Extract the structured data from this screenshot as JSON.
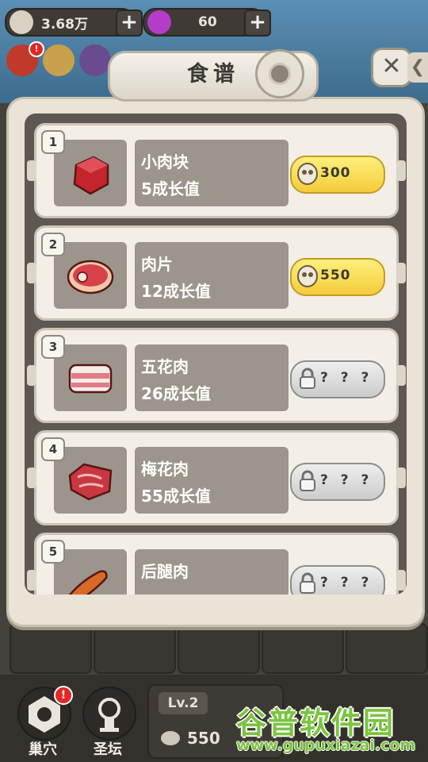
{
  "hud": {
    "bone_amount": "3.68万",
    "gem_amount": "60",
    "plus_label": "+"
  },
  "modal": {
    "title": "食谱",
    "close_label": "✕",
    "side_tab_label": "❮"
  },
  "recipes": [
    {
      "num": "1",
      "name": "小肉块",
      "growth": "5成长值",
      "state": "buy",
      "price": "300",
      "food_icon": "meat-cube-icon"
    },
    {
      "num": "2",
      "name": "肉片",
      "growth": "12成长值",
      "state": "buy",
      "price": "550",
      "food_icon": "steak-icon"
    },
    {
      "num": "3",
      "name": "五花肉",
      "growth": "26成长值",
      "state": "locked",
      "price": "? ? ?",
      "food_icon": "pork-belly-icon"
    },
    {
      "num": "4",
      "name": "梅花肉",
      "growth": "55成长值",
      "state": "locked",
      "price": "? ? ?",
      "food_icon": "pork-shoulder-icon"
    },
    {
      "num": "5",
      "name": "后腿肉",
      "growth": "",
      "state": "locked",
      "price": "? ? ?",
      "food_icon": "drumstick-icon"
    }
  ],
  "bottom": {
    "nest_label": "巢穴",
    "altar_label": "圣坛",
    "level_label": "Lv.2",
    "level_amount": "550",
    "badge_mark": "!"
  },
  "watermark": {
    "title": "谷普软件园",
    "url": "www.gupuxiazai.com"
  },
  "colors": {
    "buy_button": "#f5cb3a",
    "lock_button": "#cccccc",
    "card_bg": "#f3efe6",
    "slot_bg": "#9c958b"
  }
}
